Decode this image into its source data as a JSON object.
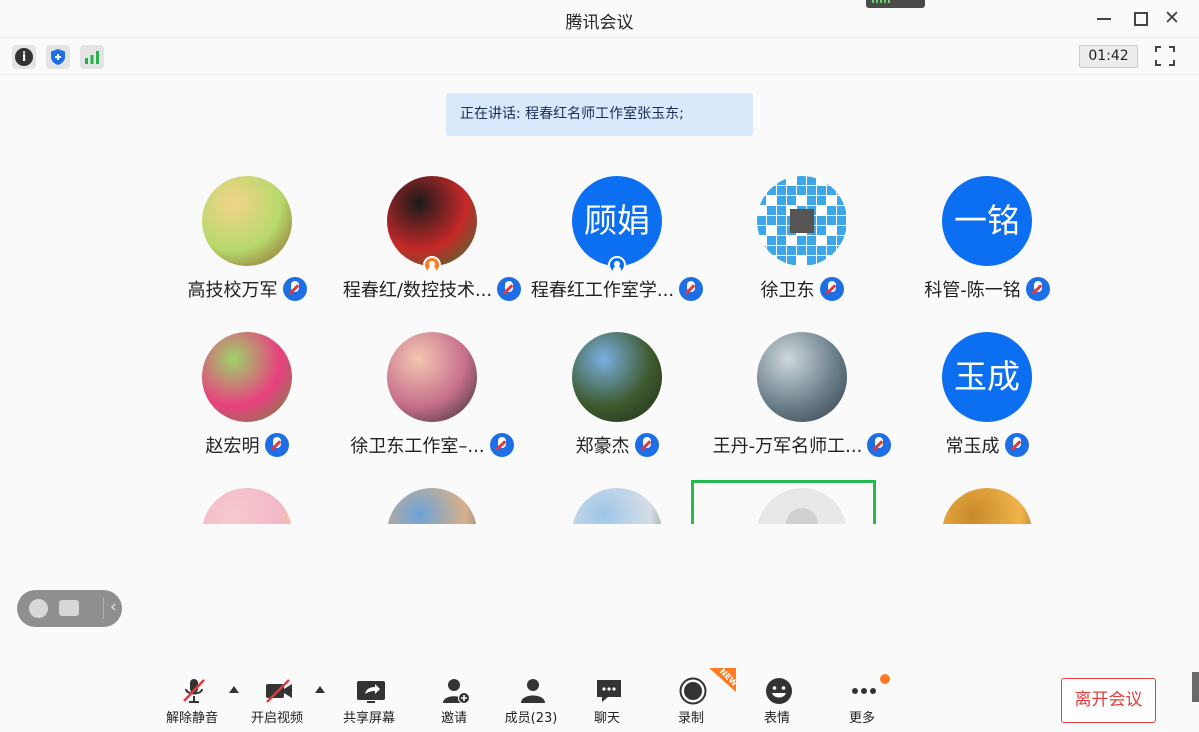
{
  "window": {
    "title": "腾讯会议"
  },
  "topbar": {
    "timer": "01:42",
    "icons": [
      "info-icon",
      "shield-icon",
      "signal-icon"
    ]
  },
  "speaking_banner": "正在讲话: 程春红名师工作室张玉东;",
  "participants": [
    {
      "name": "高技校万军",
      "avatar": "image",
      "colors": [
        "#f2d48a",
        "#b7d96b",
        "#8a5a2b"
      ]
    },
    {
      "name": "程春红/数控技术...",
      "avatar": "image",
      "host": true,
      "colors": [
        "#1b1b1b",
        "#c62828",
        "#2e7d32"
      ]
    },
    {
      "name": "程春红工作室学...",
      "avatar": "text",
      "avatar_text": "顾娟",
      "host": true
    },
    {
      "name": "徐卫东",
      "avatar": "qr"
    },
    {
      "name": "科管-陈一铭",
      "avatar": "text",
      "avatar_text": "一铭"
    },
    {
      "name": "赵宏明",
      "avatar": "image",
      "colors": [
        "#9dd36a",
        "#e8407e",
        "#6d8f3a"
      ]
    },
    {
      "name": "徐卫东工作室–...",
      "avatar": "image",
      "colors": [
        "#f3c7b0",
        "#c76f8c",
        "#2b2b2b"
      ]
    },
    {
      "name": "郑豪杰",
      "avatar": "image",
      "colors": [
        "#7ab0e0",
        "#3e5a2e",
        "#1f2e18"
      ]
    },
    {
      "name": "王丹-万军名师工...",
      "avatar": "image",
      "colors": [
        "#cfd8dc",
        "#6b7f8a",
        "#2d3b42"
      ]
    },
    {
      "name": "常玉成",
      "avatar": "text",
      "avatar_text": "玉成"
    },
    {
      "name": "",
      "avatar": "image",
      "colors": [
        "#f7c9d0",
        "#f2b8c6",
        "#f0d34a"
      ]
    },
    {
      "name": "",
      "avatar": "image",
      "colors": [
        "#6aa3d8",
        "#d8b08a",
        "#3b5e8c"
      ]
    },
    {
      "name": "",
      "avatar": "image",
      "colors": [
        "#9ec7e8",
        "#d5dde6",
        "#3f6a3c"
      ]
    },
    {
      "name": "",
      "avatar": "blank",
      "selected": true
    },
    {
      "name": "",
      "avatar": "image",
      "colors": [
        "#c9882a",
        "#f0b44a",
        "#7a3e10"
      ]
    }
  ],
  "toolbar": {
    "unmute": "解除静音",
    "start_video": "开启视频",
    "share": "共享屏幕",
    "invite": "邀请",
    "members": "成员(23)",
    "chat": "聊天",
    "record": "录制",
    "emoji": "表情",
    "more": "更多",
    "new_badge": "NEW",
    "leave": "离开会议"
  },
  "colors": {
    "accent": "#0c6ff2",
    "danger": "#e23f3f",
    "banner": "#d9e8fb",
    "selected_border": "#27b84f"
  }
}
